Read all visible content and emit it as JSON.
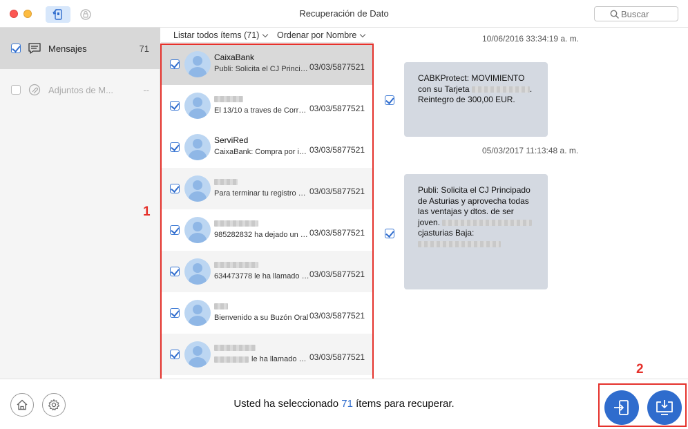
{
  "window": {
    "title": "Recuperación de Dato",
    "search_placeholder": "Buscar"
  },
  "sidebar": {
    "items": [
      {
        "label": "Mensajes",
        "count": "71",
        "checked": true
      },
      {
        "label": "Adjuntos de M...",
        "count": "--",
        "checked": false
      }
    ]
  },
  "list_header": {
    "filter_label": "Listar todos ítems (71)",
    "sort_label": "Ordenar por Nombre"
  },
  "messages": [
    {
      "name": "CaixaBank",
      "preview": "Publi: Solicita el CJ Principado de Asturias",
      "date": "03/03/5877521"
    },
    {
      "name": "",
      "preview": "El 13/10 a traves de Correos Express",
      "date": "03/03/5877521"
    },
    {
      "name": "ServiRed",
      "preview": "CaixaBank: Compra por internet",
      "date": "03/03/5877521"
    },
    {
      "name": "",
      "preview": "Para terminar tu registro Movistar",
      "date": "03/03/5877521"
    },
    {
      "name": "",
      "preview": "985282832 ha dejado un mensaje",
      "date": "03/03/5877521"
    },
    {
      "name": "",
      "preview": "634473778 le ha llamado a las",
      "date": "03/03/5877521"
    },
    {
      "name": "",
      "preview": "Bienvenido a su Buzón Oral",
      "date": "03/03/5877521"
    },
    {
      "name": "",
      "preview": "le ha llamado a las",
      "date": "03/03/5877521"
    }
  ],
  "detail": {
    "conversation": [
      {
        "timestamp": "10/06/2016 33:34:19 a. m.",
        "lines": [
          "CABKProtect: MOVIMIENTO",
          "con su Tarjeta",
          "Reintegro de 300,00 EUR."
        ]
      },
      {
        "timestamp": "05/03/2017 11:13:48 a. m.",
        "lines": [
          "Publi: Solicita el CJ Principado",
          "de Asturias y aprovecha todas",
          "las ventajas y dtos. de ser",
          "joven.",
          "cjasturias Baja:"
        ]
      }
    ]
  },
  "footer": {
    "text_before": "Usted ha seleccionado ",
    "count": "71",
    "text_after": " ítems para recuperar."
  },
  "annotations": [
    "1",
    "2"
  ],
  "colors": {
    "accent": "#2f6ccd",
    "annotation": "#e5312b",
    "bubble": "#d4d9e1"
  }
}
